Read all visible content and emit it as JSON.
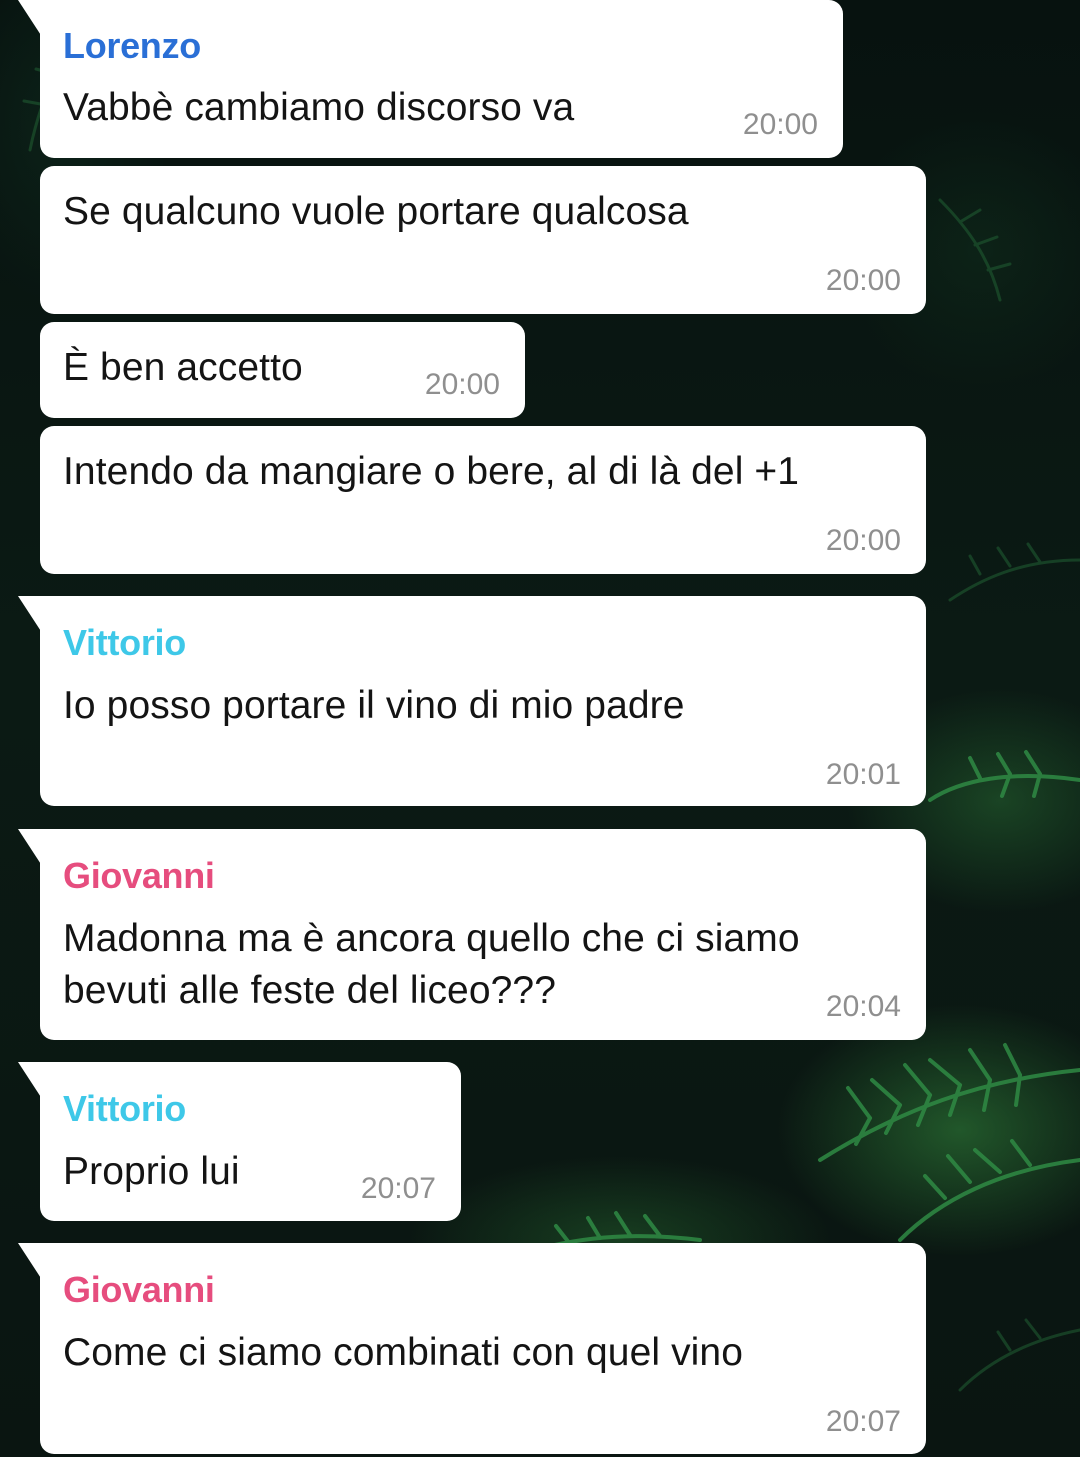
{
  "colors": {
    "lorenzo": "#2a6fd6",
    "vittorio": "#3ec8e8",
    "giovanni": "#e64d7e",
    "bubble": "#ffffff",
    "timestamp": "#8f8f8f"
  },
  "messages": [
    {
      "sender": "Lorenzo",
      "text": "Vabbè cambiamo discorso va",
      "time": "20:00"
    },
    {
      "sender": "",
      "text": "Se qualcuno vuole portare qualcosa",
      "time": "20:00"
    },
    {
      "sender": "",
      "text": "È ben accetto",
      "time": "20:00"
    },
    {
      "sender": "",
      "text": "Intendo da mangiare o bere, al di là del +1",
      "time": "20:00"
    },
    {
      "sender": "Vittorio",
      "text": "Io posso portare il vino di mio padre",
      "time": "20:01"
    },
    {
      "sender": "Giovanni",
      "text": "Madonna ma è ancora quello che ci siamo bevuti alle feste del liceo???",
      "time": "20:04"
    },
    {
      "sender": "Vittorio",
      "text": "Proprio lui",
      "time": "20:07"
    },
    {
      "sender": "Giovanni",
      "text": "Come ci siamo combinati con quel vino",
      "time": "20:07"
    }
  ]
}
